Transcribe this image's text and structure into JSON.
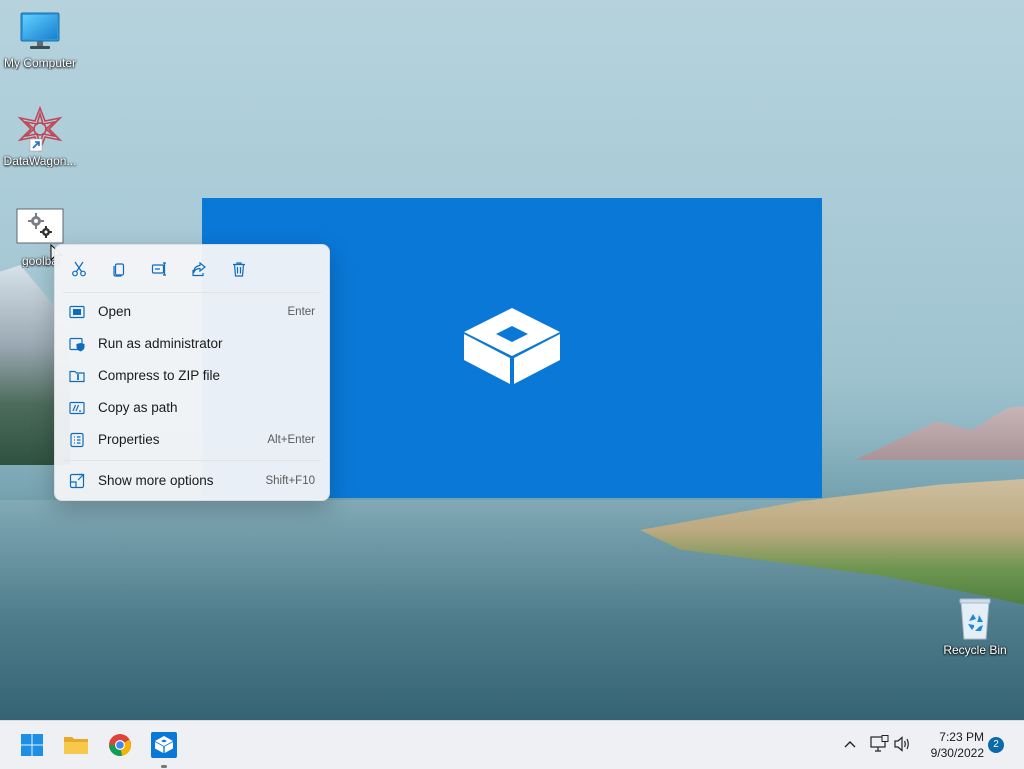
{
  "desktop": {
    "icons": [
      {
        "label": "My Computer"
      },
      {
        "label": "DataWagon..."
      },
      {
        "label": "goolba"
      },
      {
        "label": "Recycle Bin"
      }
    ]
  },
  "context_menu": {
    "quick_actions": [
      "cut-icon",
      "copy-icon",
      "rename-icon",
      "share-icon",
      "delete-icon"
    ],
    "items": [
      {
        "label": "Open",
        "shortcut": "Enter"
      },
      {
        "label": "Run as administrator",
        "shortcut": ""
      },
      {
        "label": "Compress to ZIP file",
        "shortcut": ""
      },
      {
        "label": "Copy as path",
        "shortcut": ""
      },
      {
        "label": "Properties",
        "shortcut": "Alt+Enter"
      },
      {
        "label": "Show more options",
        "shortcut": "Shift+F10"
      }
    ]
  },
  "taskbar": {
    "time": "7:23 PM",
    "date": "9/30/2022",
    "notification_count": "2"
  },
  "colors": {
    "accent": "#0a78d7",
    "menu_icon_blue": "#0f6cbd"
  }
}
